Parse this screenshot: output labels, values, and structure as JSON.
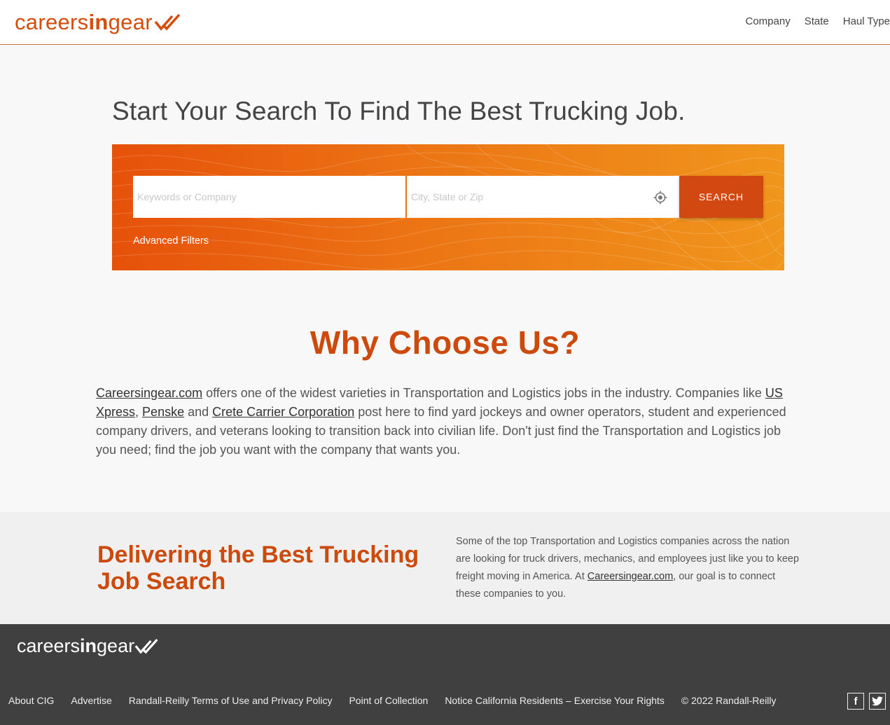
{
  "header": {
    "logo": {
      "pre": "careers",
      "bold": "in",
      "post": "gear"
    },
    "nav": [
      "Company",
      "State",
      "Haul Type"
    ]
  },
  "hero": {
    "title": "Start Your Search To Find The Best Trucking Job.",
    "keyword_placeholder": "Keywords or Company",
    "location_placeholder": "City, State or Zip",
    "search_label": "SEARCH",
    "advanced_filters": "Advanced Filters"
  },
  "why": {
    "title": "Why Choose Us?",
    "link1": "Careersingear.com",
    "text1": " offers one of the widest varieties in Transportation and Logistics jobs in the industry. Companies like ",
    "link2": "US Xpress",
    "sep1": ", ",
    "link3": "Penske",
    "sep2": " and ",
    "link4": "Crete Carrier Corporation",
    "text2": " post here to find yard jockeys and owner operators, student and experienced company drivers, and veterans looking to transition back into civilian life. Don't just find the Transportation and Logistics job you need; find the job you want with the company that wants you."
  },
  "deliver": {
    "title": "Delivering the Best Trucking Job Search",
    "text1": "Some of the top Transportation and Logistics companies across the nation are looking for truck drivers, mechanics, and employees just like you to keep freight moving in America. At ",
    "link": "Careersingear.com",
    "text2": ", our goal is to connect these companies to you."
  },
  "footer": {
    "logo": {
      "pre": "careers",
      "bold": "in",
      "post": "gear"
    },
    "links": [
      "About CIG",
      "Advertise",
      "Randall-Reilly Terms of Use and Privacy Policy",
      "Point of Collection",
      "Notice California Residents – Exercise Your Rights"
    ],
    "copyright": "© 2022 Randall-Reilly",
    "social": {
      "facebook": "f",
      "twitter": "t"
    }
  },
  "colors": {
    "brand": "#d64c0a",
    "footer_bg": "#404040",
    "banner_start": "#e6510a",
    "banner_end": "#f0961c"
  }
}
